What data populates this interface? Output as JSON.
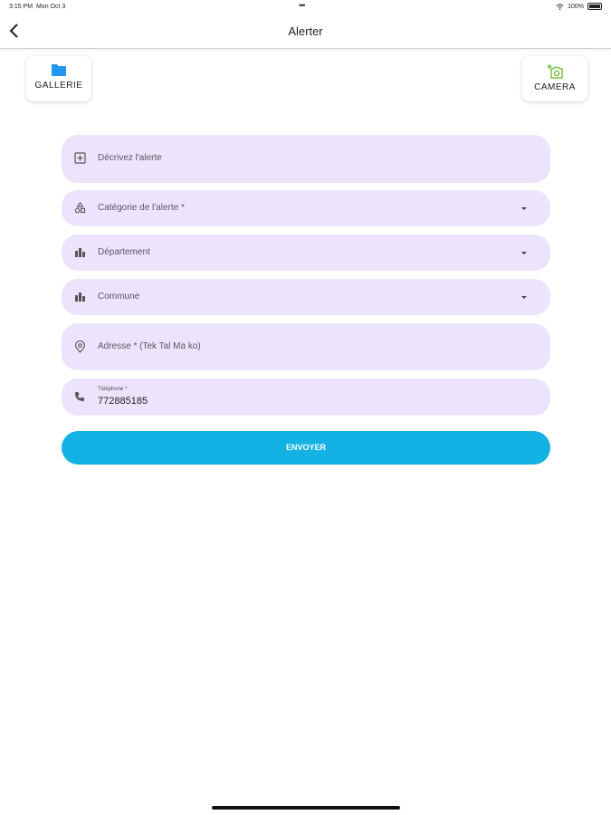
{
  "status_bar": {
    "time": "3:15 PM",
    "date": "Mon Oct 3",
    "dots": "•••",
    "battery": "100%"
  },
  "header": {
    "title": "Alerter",
    "back_icon": "chevron-left-icon"
  },
  "media": {
    "gallery": {
      "label": "GALLERIE",
      "icon": "folder-icon",
      "color": "#2196f3"
    },
    "camera": {
      "label": "CAMERA",
      "icon": "add-photo-icon",
      "color": "#7cc142"
    }
  },
  "form": {
    "description": {
      "placeholder": "Décrivez l'alerte",
      "icon": "add-box-icon"
    },
    "category": {
      "placeholder": "Catégorie de l'alerte *",
      "icon": "category-icon"
    },
    "department": {
      "placeholder": "Département",
      "icon": "buildings-icon"
    },
    "commune": {
      "placeholder": "Commune",
      "icon": "buildings-icon"
    },
    "address": {
      "placeholder": "Adresse * (Tek Tal Ma ko)",
      "icon": "location-icon"
    },
    "phone": {
      "label": "Téléphone *",
      "value": "772885185",
      "icon": "phone-icon"
    }
  },
  "submit": {
    "label": "ENVOYER",
    "color": "#13b1e4"
  },
  "colors": {
    "field_bg": "#ece3fc"
  }
}
